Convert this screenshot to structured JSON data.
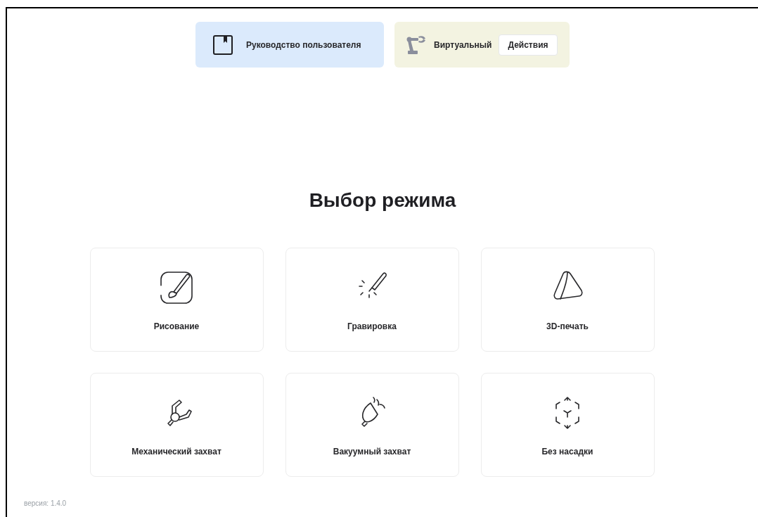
{
  "header": {
    "manual_button": "Руководство пользователя",
    "robot_status": "Виртуальный",
    "actions_button": "Действия"
  },
  "title": "Выбор режима",
  "modes": [
    {
      "label": "Рисование",
      "kind": "drawing"
    },
    {
      "label": "Гравировка",
      "kind": "engraving"
    },
    {
      "label": "3D-печать",
      "kind": "printing"
    },
    {
      "label": "Механический захват",
      "kind": "gripper"
    },
    {
      "label": "Вакуумный захват",
      "kind": "vacuum"
    },
    {
      "label": "Без насадки",
      "kind": "none"
    }
  ],
  "version": "версия: 1.4.0"
}
